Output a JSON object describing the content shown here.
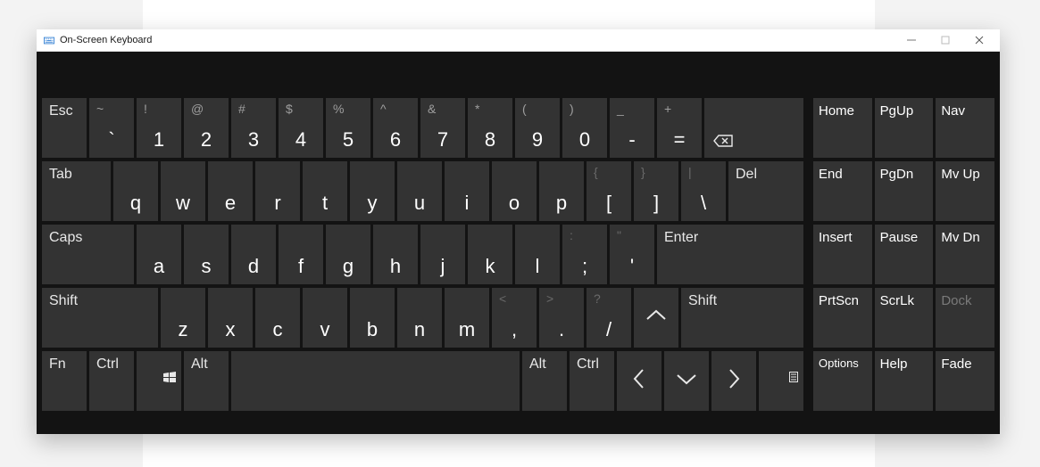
{
  "window": {
    "title": "On-Screen Keyboard"
  },
  "rows": {
    "r1": {
      "esc": "Esc",
      "k1": {
        "u": "~",
        "l": "`"
      },
      "k2": {
        "u": "!",
        "l": "1"
      },
      "k3": {
        "u": "@",
        "l": "2"
      },
      "k4": {
        "u": "#",
        "l": "3"
      },
      "k5": {
        "u": "$",
        "l": "4"
      },
      "k6": {
        "u": "%",
        "l": "5"
      },
      "k7": {
        "u": "^",
        "l": "6"
      },
      "k8": {
        "u": "&",
        "l": "7"
      },
      "k9": {
        "u": "*",
        "l": "8"
      },
      "k10": {
        "u": "(",
        "l": "9"
      },
      "k11": {
        "u": ")",
        "l": "0"
      },
      "k12": {
        "u": "_",
        "l": "-"
      },
      "k13": {
        "u": "+",
        "l": "="
      }
    },
    "r2": {
      "tab": "Tab",
      "q": "q",
      "w": "w",
      "e": "e",
      "r": "r",
      "t": "t",
      "y": "y",
      "u": "u",
      "i": "i",
      "o": "o",
      "p": "p",
      "br1": {
        "u": "{",
        "l": "["
      },
      "br2": {
        "u": "}",
        "l": "]"
      },
      "bs": {
        "u": "|",
        "l": "\\"
      },
      "del": "Del"
    },
    "r3": {
      "caps": "Caps",
      "a": "a",
      "s": "s",
      "d": "d",
      "f": "f",
      "g": "g",
      "h": "h",
      "j": "j",
      "k": "k",
      "l": "l",
      "sc": {
        "u": ":",
        "l": ";"
      },
      "qt": {
        "u": "\"",
        "l": "'"
      },
      "enter": "Enter"
    },
    "r4": {
      "lshift": "Shift",
      "z": "z",
      "x": "x",
      "c": "c",
      "v": "v",
      "b": "b",
      "n": "n",
      "m": "m",
      "cm": {
        "u": "<",
        "l": ","
      },
      "pd": {
        "u": ">",
        "l": "."
      },
      "sl": {
        "u": "?",
        "l": "/"
      },
      "rshift": "Shift"
    },
    "r5": {
      "fn": "Fn",
      "lctrl": "Ctrl",
      "lalt": "Alt",
      "ralt": "Alt",
      "rctrl": "Ctrl"
    }
  },
  "side": {
    "r1": [
      "Home",
      "PgUp",
      "Nav"
    ],
    "r2": [
      "End",
      "PgDn",
      "Mv Up"
    ],
    "r3": [
      "Insert",
      "Pause",
      "Mv Dn"
    ],
    "r4": [
      "PrtScn",
      "ScrLk",
      "Dock"
    ],
    "r5": [
      "Options",
      "Help",
      "Fade"
    ]
  }
}
